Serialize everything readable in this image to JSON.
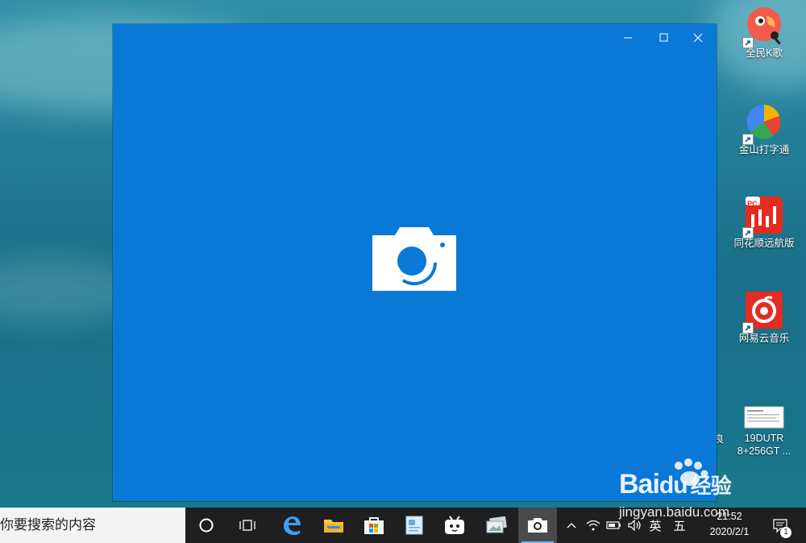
{
  "desktop": {
    "icons": [
      {
        "label": "全民K歌",
        "icon": "karaoke-parrot-icon"
      },
      {
        "label": "金山打字通",
        "icon": "kingsoft-typing-pinwheel-icon"
      },
      {
        "label": "同花顺远航版",
        "icon": "tonghuashun-stock-icon",
        "badge": "PC"
      },
      {
        "label": "网易云音乐",
        "icon": "netease-cloud-music-icon"
      },
      {
        "label": "19DUTR\n8+256GT ...",
        "label_line1": "19DUTR",
        "label_line2": "8+256GT ...",
        "icon": "document-thumbnail-icon"
      }
    ],
    "partial_label": "良"
  },
  "window": {
    "app": "Camera",
    "background_color": "#0a78d7",
    "controls": {
      "minimize": "minimize-icon",
      "maximize": "maximize-icon",
      "close": "close-icon"
    },
    "center_icon": "camera-icon"
  },
  "taskbar": {
    "search_placeholder": "你要搜索的内容",
    "apps": [
      "cortana-icon",
      "task-view-icon",
      "edge-icon",
      "file-explorer-icon",
      "store-icon",
      "notepad-icon",
      "bilibili-icon",
      "photos-icon",
      "camera-icon"
    ],
    "active_app": "camera-icon",
    "tray": {
      "ime_lang": "英",
      "ime_mode": "五",
      "time": "21:52",
      "date": "2020/2/1",
      "notification_count": "1"
    }
  },
  "watermark": {
    "brand": "Bai",
    "brand_suffix": "du",
    "brand_cn": "经验",
    "url": "jingyan.baidu.com"
  },
  "colors": {
    "accent": "#0a78d7",
    "taskbar": "#1f1f1f"
  }
}
